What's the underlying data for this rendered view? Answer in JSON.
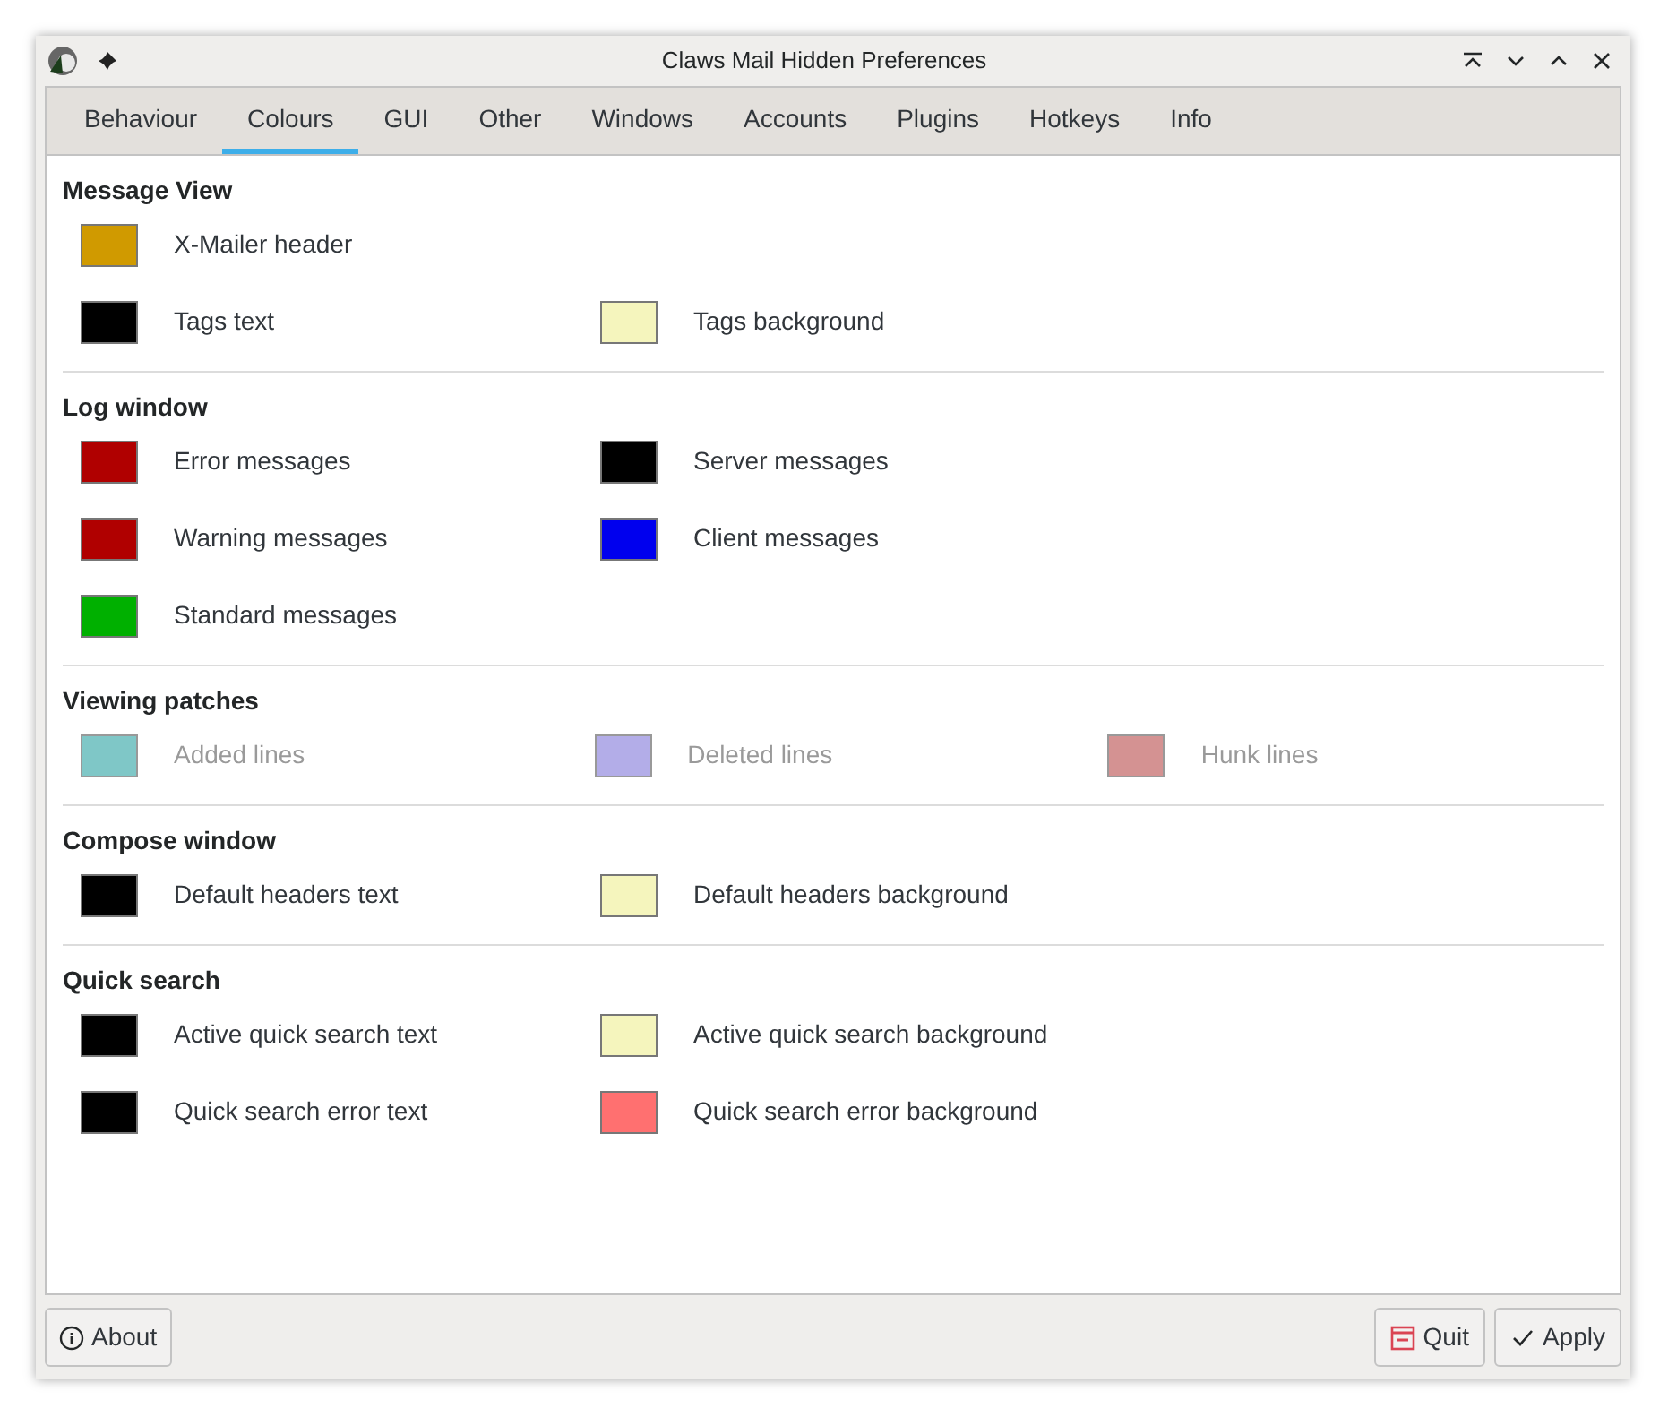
{
  "window": {
    "title": "Claws Mail Hidden Preferences"
  },
  "tabs": [
    {
      "label": "Behaviour",
      "selected": false
    },
    {
      "label": "Colours",
      "selected": true
    },
    {
      "label": "GUI",
      "selected": false
    },
    {
      "label": "Other",
      "selected": false
    },
    {
      "label": "Windows",
      "selected": false
    },
    {
      "label": "Accounts",
      "selected": false
    },
    {
      "label": "Plugins",
      "selected": false
    },
    {
      "label": "Hotkeys",
      "selected": false
    },
    {
      "label": "Info",
      "selected": false
    }
  ],
  "sections": [
    {
      "title": "Message View",
      "rows": [
        [
          {
            "label": "X-Mailer header",
            "color": "#d09a00",
            "disabled": false
          }
        ],
        [
          {
            "label": "Tags text",
            "color": "#000000",
            "disabled": false
          },
          {
            "label": "Tags background",
            "color": "#f5f5bd",
            "disabled": false
          }
        ]
      ]
    },
    {
      "title": "Log window",
      "rows": [
        [
          {
            "label": "Error messages",
            "color": "#b00000",
            "disabled": false
          },
          {
            "label": "Server messages",
            "color": "#000000",
            "disabled": false
          }
        ],
        [
          {
            "label": "Warning messages",
            "color": "#b00000",
            "disabled": false
          },
          {
            "label": "Client messages",
            "color": "#0000ee",
            "disabled": false
          }
        ],
        [
          {
            "label": "Standard messages",
            "color": "#00b000",
            "disabled": false
          }
        ]
      ]
    },
    {
      "title": "Viewing patches",
      "rows": [
        [
          {
            "label": "Added lines",
            "color": "#7fc7c7",
            "disabled": true
          },
          {
            "label": "Deleted lines",
            "color": "#b3ade8",
            "disabled": true
          },
          {
            "label": "Hunk lines",
            "color": "#d49292",
            "disabled": true
          }
        ]
      ]
    },
    {
      "title": "Compose window",
      "rows": [
        [
          {
            "label": "Default headers text",
            "color": "#000000",
            "disabled": false
          },
          {
            "label": "Default headers background",
            "color": "#f5f5bd",
            "disabled": false
          }
        ]
      ]
    },
    {
      "title": "Quick search",
      "rows": [
        [
          {
            "label": "Active quick search text",
            "color": "#000000",
            "disabled": false
          },
          {
            "label": "Active quick search background",
            "color": "#f5f5bd",
            "disabled": false
          }
        ],
        [
          {
            "label": "Quick search error text",
            "color": "#000000",
            "disabled": false
          },
          {
            "label": "Quick search error background",
            "color": "#ff7070",
            "disabled": false
          }
        ]
      ]
    }
  ],
  "buttons": {
    "about": "About",
    "quit": "Quit",
    "apply": "Apply"
  }
}
